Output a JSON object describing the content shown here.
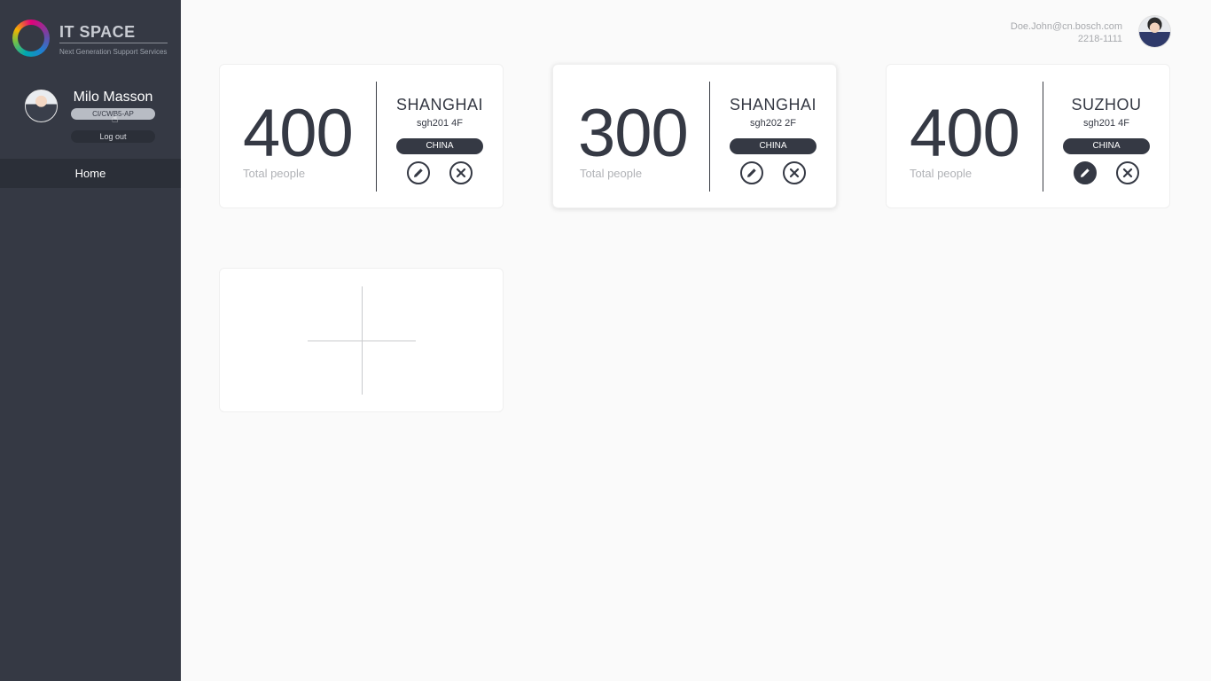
{
  "sidebar": {
    "logo_title": "IT SPACE",
    "logo_subtitle": "Next Generation Support Services",
    "user": {
      "name": "Milo Masson",
      "department": "CI/CWB5-AP",
      "logout_label": "Log out"
    },
    "nav": [
      {
        "label": "Home",
        "active": true
      }
    ]
  },
  "header": {
    "email": "Doe.John@cn.bosch.com",
    "phone_ext": "2218-1111"
  },
  "cards": [
    {
      "count": "400",
      "count_label": "Total people",
      "city": "SHANGHAI",
      "room": "sgh201 4F",
      "country": "CHINA"
    },
    {
      "count": "300",
      "count_label": "Total people",
      "city": "SHANGHAI",
      "room": "sgh202 2F",
      "country": "CHINA"
    },
    {
      "count": "400",
      "count_label": "Total people",
      "city": "SUZHOU",
      "room": "sgh201 4F",
      "country": "CHINA"
    }
  ],
  "colors": {
    "sidebar_bg": "#353944",
    "page_bg": "#fafafa",
    "accent_dark": "#353944"
  }
}
